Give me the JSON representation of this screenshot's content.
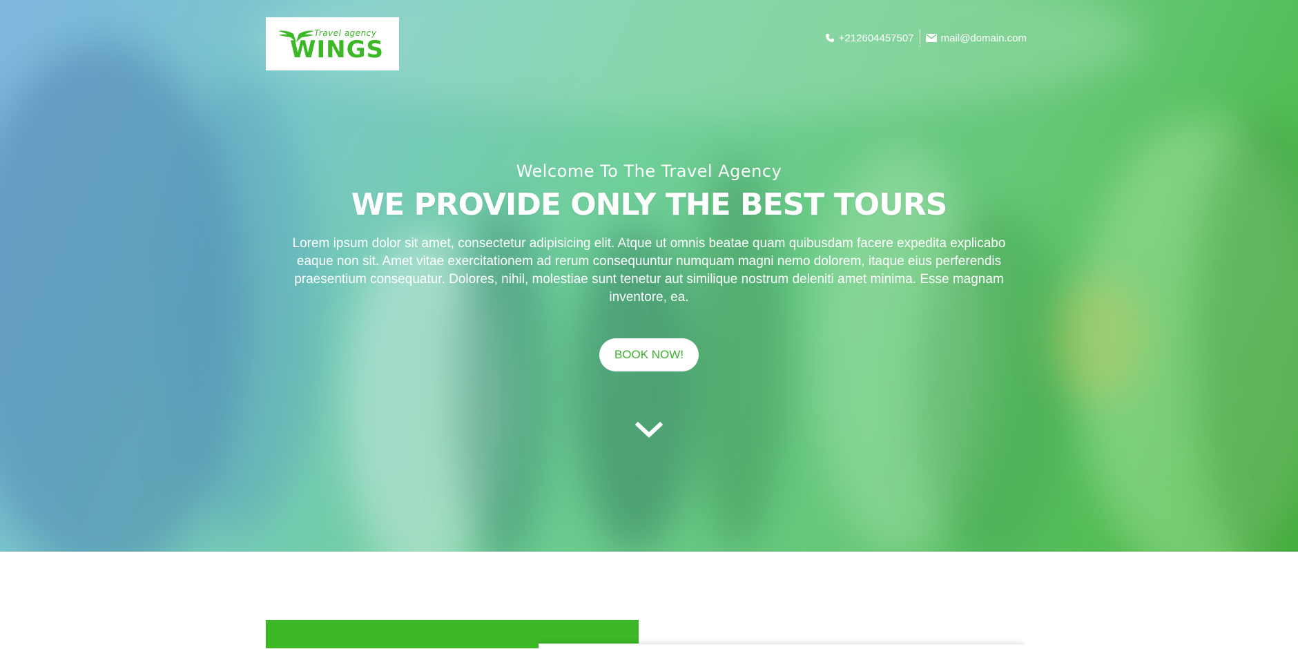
{
  "brand": {
    "tagline": "Travel agency",
    "name": "WINGS",
    "color": "#3cb827",
    "icon": "wings-icon"
  },
  "contact": {
    "phone": "+212604457507",
    "phone_icon": "phone-icon",
    "email": "mail@domain.com",
    "email_icon": "envelope-icon"
  },
  "hero": {
    "welcome": "Welcome To The Travel Agency",
    "headline": "WE PROVIDE ONLY THE BEST TOURS",
    "lead": "Lorem ipsum dolor sit amet, consectetur adipisicing elit. Atque ut omnis beatae quam quibusdam facere expedita explicabo eaque non sit. Amet vitae exercitationem ad rerum consequuntur numquam magni nemo dolorem, itaque eius perferendis praesentium consequatur. Dolores, nihil, molestiae sunt tenetur aut similique nostrum deleniti amet minima. Esse magnam inventore, ea.",
    "cta_label": "BOOK NOW!",
    "scroll_icon": "chevron-down-icon",
    "overlay_colors": [
      "#7fb6e0",
      "#6fcf9a",
      "#43b43a"
    ]
  }
}
